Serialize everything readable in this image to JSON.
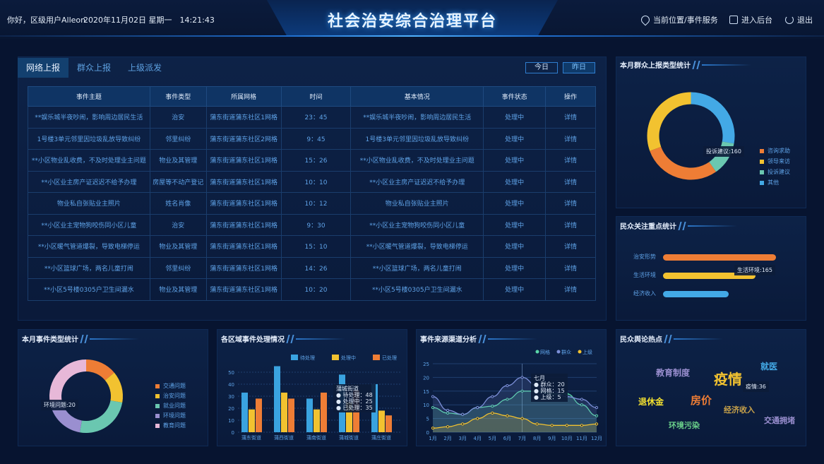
{
  "header": {
    "greeting": "你好，区级用户Alleon",
    "datetime": "2020年11月02日 星期一　14:21:43",
    "title": "社会治安综合治理平台",
    "location": "当前位置/事件服务",
    "backend": "进入后台",
    "logout": "退出"
  },
  "events": {
    "tabs": [
      "网络上报",
      "群众上报",
      "上级派发"
    ],
    "today": "今日",
    "yesterday": "昨日",
    "columns": [
      "事件主题",
      "事件类型",
      "所属网格",
      "时间",
      "基本情况",
      "事件状态",
      "操作"
    ],
    "rows": [
      [
        "**娱乐城半夜吵闹，影响周边居民生活",
        "治安",
        "蒲东街道蒲东社区1网格",
        "23：45",
        "**娱乐城半夜吵闹，影响周边居民生活",
        "处理中",
        "详情"
      ],
      [
        "1号楼3单元邻里因垃圾乱放导致纠纷",
        "邻里纠纷",
        "蒲东街道蒲东社区2网格",
        "9：45",
        "1号楼3单元邻里因垃圾乱放导致纠纷",
        "处理中",
        "详情"
      ],
      [
        "**小区物业乱收费，不及时处理业主问题",
        "物业及其管理",
        "蒲东街道蒲东社区1网格",
        "15：26",
        "**小区物业乱收费，不及时处理业主问题",
        "处理中",
        "详情"
      ],
      [
        "**小区业主房产证迟迟不给予办理",
        "房屋等不动产登记",
        "蒲东街道蒲东社区1网格",
        "10：10",
        "**小区业主房产证迟迟不给予办理",
        "处理中",
        "详情"
      ],
      [
        "物业私自张贴业主照片",
        "姓名肖像",
        "蒲东街道蒲东社区1网格",
        "10：12",
        "物业私自张贴业主照片",
        "处理中",
        "详情"
      ],
      [
        "**小区业主宠物狗咬伤同小区儿童",
        "治安",
        "蒲东街道蒲东社区1网格",
        "9：30",
        "**小区业主宠物狗咬伤同小区儿童",
        "处理中",
        "详情"
      ],
      [
        "**小区暖气管道爆裂，导致电梯停运",
        "物业及其管理",
        "蒲东街道蒲东社区1网格",
        "15：10",
        "**小区暖气管道爆裂，导致电梯停运",
        "处理中",
        "详情"
      ],
      [
        "**小区篮球广场，两名儿童打闹",
        "邻里纠纷",
        "蒲东街道蒲东社区1网格",
        "14：26",
        "**小区篮球广场，两名儿童打闹",
        "处理中",
        "详情"
      ],
      [
        "**小区5号楼0305户卫生间漏水",
        "物业及其管理",
        "蒲东街道蒲东社区1网格",
        "10：20",
        "**小区5号楼0305户卫生间漏水",
        "处理中",
        "详情"
      ]
    ]
  },
  "report_types": {
    "title": "本月群众上报类型统计",
    "tooltip": "投诉建议:160",
    "legend": [
      "咨询求助",
      "领导来访",
      "投诉建议",
      "其他"
    ],
    "colors": [
      "#ee7d35",
      "#f2c230",
      "#6ac7b0",
      "#43a9e6"
    ]
  },
  "focus": {
    "title": "民众关注重点统计",
    "tooltip": "生活环境:165",
    "chart_data": {
      "type": "bar",
      "categories": [
        "治安形势",
        "生活环境",
        "经济收入"
      ],
      "values": [
        100,
        82,
        58
      ],
      "colors": [
        "#ee7d35",
        "#f2c230",
        "#43a9e6"
      ]
    }
  },
  "event_types": {
    "title": "本月事件类型统计",
    "tooltip": "环境问题:20",
    "legend": [
      "交通问题",
      "治安问题",
      "就业问题",
      "环境问题",
      "教育问题"
    ],
    "colors": [
      "#ee7d35",
      "#f2c230",
      "#6ac7b0",
      "#9a8fd0",
      "#e7b8d8"
    ]
  },
  "region": {
    "title": "各区域事件处理情况",
    "tip_title": "蒲城街道",
    "tip_lines": [
      "● 待处理：48",
      "● 处理中：25",
      "● 已处理：35"
    ],
    "chart_data": {
      "type": "bar",
      "categories": [
        "蒲东街道",
        "蒲西街道",
        "蒲南街道",
        "蒲城街道",
        "蒲庄街道"
      ],
      "ylim": [
        0,
        50
      ],
      "yticks": [
        0,
        10,
        20,
        30,
        40,
        50
      ],
      "series": [
        {
          "name": "待处理",
          "values": [
            33,
            55,
            28,
            48,
            40
          ],
          "color": "#3aa3e0"
        },
        {
          "name": "处理中",
          "values": [
            19,
            33,
            19,
            25,
            18
          ],
          "color": "#f2c230"
        },
        {
          "name": "已处理",
          "values": [
            28,
            28,
            33,
            35,
            14
          ],
          "color": "#ee7d35"
        }
      ]
    }
  },
  "source": {
    "title": "事件来源渠道分析",
    "tip_title": "七月",
    "tip_lines": [
      "● 群众：20",
      "● 网格：15",
      "● 上级：5"
    ],
    "chart_data": {
      "type": "line",
      "x": [
        "1月",
        "2月",
        "3月",
        "4月",
        "5月",
        "6月",
        "7月",
        "8月",
        "9月",
        "10月",
        "11月",
        "12月"
      ],
      "ylim": [
        0,
        25
      ],
      "yticks": [
        0,
        5,
        10,
        15,
        20,
        25
      ],
      "series": [
        {
          "name": "网格",
          "values": [
            9,
            7,
            6.5,
            9,
            9.5,
            12,
            15,
            15,
            14,
            14,
            10,
            6
          ],
          "color": "#5ad6a8"
        },
        {
          "name": "群众",
          "values": [
            13,
            8,
            6.5,
            9,
            13,
            17,
            20,
            17,
            15,
            13,
            12,
            9
          ],
          "color": "#7c8fd8"
        },
        {
          "name": "上级",
          "values": [
            1.5,
            2,
            3,
            5,
            7,
            6,
            5,
            3,
            2.5,
            2.5,
            2.5,
            3
          ],
          "color": "#f2c230"
        }
      ]
    }
  },
  "hot": {
    "title": "民众舆论热点",
    "tooltip": "疫情:36",
    "words": [
      {
        "text": "教育制度",
        "color": "#9a8fd0",
        "size": 12
      },
      {
        "text": "疫情",
        "color": "#f2c230",
        "size": 20
      },
      {
        "text": "就医",
        "color": "#43a9e6",
        "size": 12
      },
      {
        "text": "退休金",
        "color": "#f2e030",
        "size": 12
      },
      {
        "text": "房价",
        "color": "#ee7d35",
        "size": 15
      },
      {
        "text": "经济收入",
        "color": "#c8a24a",
        "size": 11
      },
      {
        "text": "环境污染",
        "color": "#6ad08a",
        "size": 11
      },
      {
        "text": "交通拥堵",
        "color": "#9a8fd0",
        "size": 11
      }
    ]
  }
}
